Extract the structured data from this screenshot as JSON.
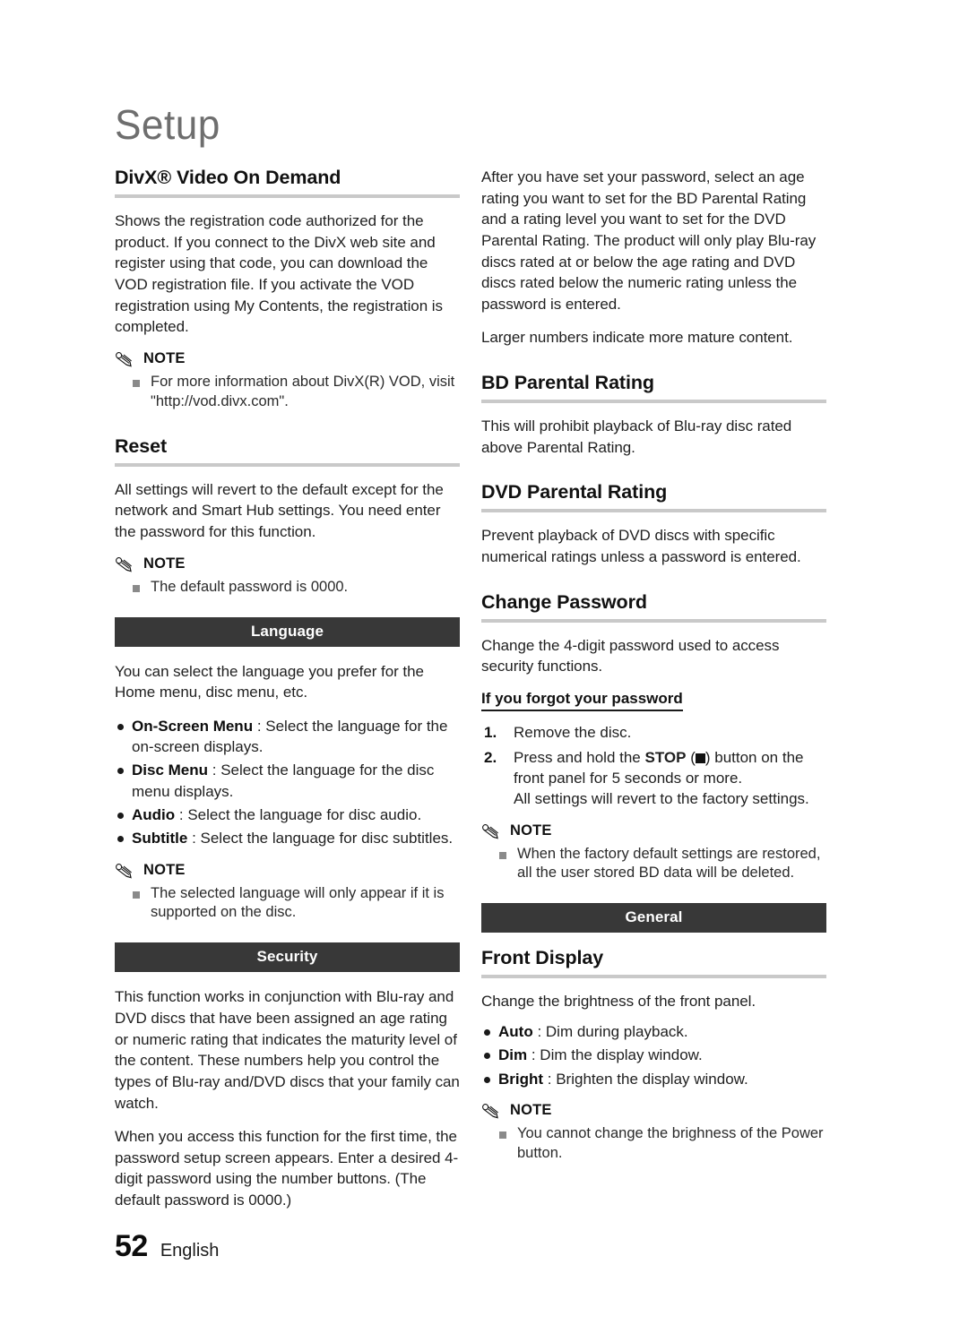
{
  "chapter": {
    "title": "Setup"
  },
  "footer": {
    "page_number": "52",
    "language": "English"
  },
  "colors": {
    "section_bar": "#383838",
    "heading_rule": "#c9c9c9",
    "bullet_square": "#8a8a8a"
  },
  "icons": {
    "note": "pencil-icon",
    "stop": "stop-square-icon"
  },
  "left_column": {
    "divx": {
      "heading": "DivX® Video On Demand",
      "body": "Shows the registration code authorized for the product. If you connect to the DivX web site and register using that code, you can download the VOD registration file. If you activate the VOD registration using My Contents, the registration is completed.",
      "note_label": "NOTE",
      "note_items": [
        "For more information about DivX(R) VOD, visit \"http://vod.divx.com\"."
      ]
    },
    "reset": {
      "heading": "Reset",
      "body": "All settings will revert to the default except for the network and Smart Hub settings. You need enter the password for this function.",
      "note_label": "NOTE",
      "note_items": [
        "The default password is 0000."
      ]
    },
    "language_section": {
      "bar_label": "Language",
      "intro": "You can select the language you prefer for the Home menu, disc menu, etc.",
      "options": [
        {
          "term": "On-Screen Menu",
          "sep": " : ",
          "desc": "Select the language for the on-screen displays."
        },
        {
          "term": "Disc Menu",
          "sep": " : ",
          "desc": "Select the language for the disc menu displays."
        },
        {
          "term": "Audio",
          "sep": " : ",
          "desc": "Select the language for disc audio."
        },
        {
          "term": "Subtitle",
          "sep": " : ",
          "desc": "Select the language for disc subtitles."
        }
      ],
      "note_label": "NOTE",
      "note_items": [
        "The selected language will only appear if it is supported on the disc."
      ]
    },
    "security_section": {
      "bar_label": "Security",
      "paragraph_1": "This function works in conjunction with Blu-ray and DVD discs that have been assigned an age rating or numeric rating that indicates the maturity level of the content. These numbers help you control the types of Blu-ray and/DVD discs that your family can watch.",
      "paragraph_2": "When you access this function for the first time, the password setup screen appears. Enter a desired 4-digit password using the number buttons. (The default password is 0000.)"
    }
  },
  "right_column": {
    "intro": {
      "paragraph_1": "After you have set your password, select an age rating you want to set for the BD Parental Rating and a rating level you want to set for the DVD Parental Rating. The product will only play Blu-ray discs rated at or below the age rating and DVD discs rated below the numeric rating unless the password is entered.",
      "paragraph_2": "Larger numbers indicate more mature content."
    },
    "bd_parental": {
      "heading": "BD Parental Rating",
      "body": "This will prohibit playback of Blu-ray disc rated above Parental Rating."
    },
    "dvd_parental": {
      "heading": "DVD Parental Rating",
      "body": "Prevent playback of DVD discs with specific numerical ratings unless a password is entered."
    },
    "change_password": {
      "heading": "Change Password",
      "body": "Change the 4-digit password used to access security functions.",
      "subheading": "If you forgot your password",
      "steps": [
        {
          "num": "1.",
          "before": "Remove the disc.",
          "after": "",
          "bold": "",
          "has_square": false,
          "extra": ""
        },
        {
          "num": "2.",
          "before": "Press and hold the ",
          "bold": "STOP",
          "mid": " (",
          "has_square": true,
          "after": ") button on the front panel for 5 seconds or more.",
          "extra": "All settings will revert to the factory settings."
        }
      ],
      "note_label": "NOTE",
      "note_items": [
        "When the factory default settings are restored, all the user stored BD data will be deleted."
      ]
    },
    "general_section": {
      "bar_label": "General"
    },
    "front_display": {
      "heading": "Front Display",
      "body": "Change the brightness of the front panel.",
      "options": [
        {
          "term": "Auto",
          "sep": " : ",
          "desc": "Dim during playback."
        },
        {
          "term": "Dim",
          "sep": " : ",
          "desc": "Dim the display window."
        },
        {
          "term": "Bright",
          "sep": " : ",
          "desc": "Brighten the display window."
        }
      ],
      "note_label": "NOTE",
      "note_items": [
        "You cannot change the brighness of the Power button."
      ]
    }
  }
}
